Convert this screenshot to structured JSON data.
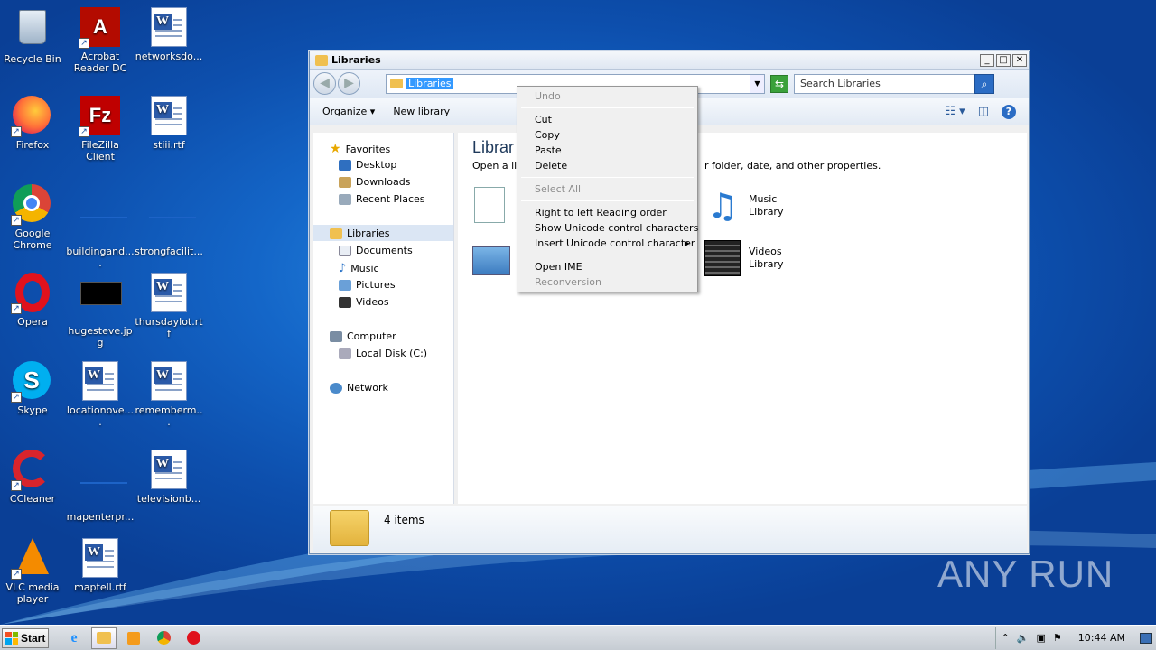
{
  "desktop": {
    "icons": [
      {
        "label": "Recycle Bin"
      },
      {
        "label": "Acrobat Reader DC"
      },
      {
        "label": "networksdo..."
      },
      {
        "label": "Firefox"
      },
      {
        "label": "FileZilla Client"
      },
      {
        "label": "stiii.rtf"
      },
      {
        "label": "Google Chrome"
      },
      {
        "label": "buildingand...."
      },
      {
        "label": "strongfacilit..."
      },
      {
        "label": "Opera"
      },
      {
        "label": "hugesteve.jpg"
      },
      {
        "label": "thursdaylot.rtf"
      },
      {
        "label": "Skype"
      },
      {
        "label": "locationove...."
      },
      {
        "label": "rememberm..."
      },
      {
        "label": "CCleaner"
      },
      {
        "label": "mapenterpr..."
      },
      {
        "label": "televisionb..."
      },
      {
        "label": "VLC media player"
      },
      {
        "label": "maptell.rtf"
      }
    ]
  },
  "window": {
    "title": "Libraries",
    "address": "Libraries",
    "search_placeholder": "Search Libraries",
    "organize": "Organize",
    "new_library": "New library",
    "nav": {
      "favorites": "Favorites",
      "desktop": "Desktop",
      "downloads": "Downloads",
      "recent": "Recent Places",
      "libraries": "Libraries",
      "documents": "Documents",
      "music": "Music",
      "pictures": "Pictures",
      "videos": "Videos",
      "computer": "Computer",
      "local_disk": "Local Disk (C:)",
      "network": "Network"
    },
    "content": {
      "heading": "Librar",
      "desc_left": "Open a libr",
      "desc_right": "r folder, date, and other properties.",
      "music": "Music",
      "music_sub": "Library",
      "videos": "Videos",
      "videos_sub": "Library"
    },
    "status": "4 items"
  },
  "menu": {
    "undo": "Undo",
    "cut": "Cut",
    "copy": "Copy",
    "paste": "Paste",
    "delete": "Delete",
    "select_all": "Select All",
    "rtl": "Right to left Reading order",
    "show_unicode": "Show Unicode control characters",
    "insert_unicode": "Insert Unicode control character",
    "open_ime": "Open IME",
    "reconversion": "Reconversion"
  },
  "taskbar": {
    "start": "Start",
    "clock": "10:44 AM"
  },
  "watermark": "ANY RUN"
}
